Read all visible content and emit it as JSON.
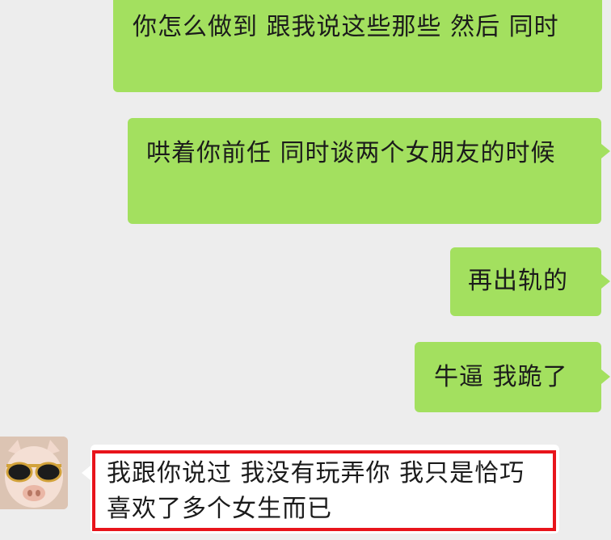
{
  "messages": [
    {
      "sender": "self",
      "text": "你怎么做到 跟我说这些那些 然后 同时"
    },
    {
      "sender": "self",
      "text": "哄着你前任 同时谈两个女朋友的时候"
    },
    {
      "sender": "self",
      "text": "再出轨的"
    },
    {
      "sender": "self",
      "text": "牛逼 我跪了"
    },
    {
      "sender": "other",
      "text": "我跟你说过 我没有玩弄你 我只是恰巧喜欢了多个女生而已"
    }
  ],
  "colors": {
    "background": "#ededed",
    "outgoing_bubble": "#a3e05f",
    "incoming_bubble": "#ffffff",
    "highlight_border": "#e8141b"
  },
  "icons": {
    "avatar": "pig-with-sunglasses-avatar"
  }
}
